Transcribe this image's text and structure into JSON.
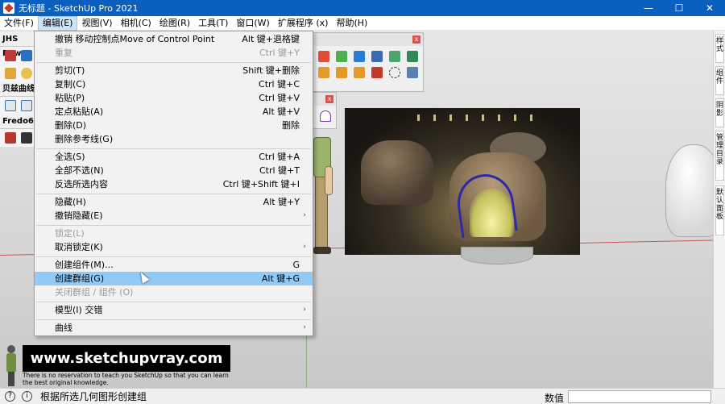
{
  "window": {
    "title": "无标题 - SketchUp Pro 2021",
    "controls": [
      "—",
      "☐",
      "✕"
    ]
  },
  "menubar": [
    "文件(F)",
    "编辑(E)",
    "视图(V)",
    "相机(C)",
    "绘图(R)",
    "工具(T)",
    "窗口(W)",
    "扩展程序 (x)",
    "帮助(H)"
  ],
  "left_toolbars": {
    "jhs_title": "JHS Pow",
    "bezier_title": "贝兹曲线",
    "fredo_title": "Fredo6_"
  },
  "edit_menu": [
    {
      "label": "撤销 移动控制点Move of Control Point",
      "shortcut": "Alt 键+退格键",
      "disabled": false
    },
    {
      "label": "重复",
      "shortcut": "Ctrl 键+Y",
      "disabled": true
    },
    {
      "sep": true
    },
    {
      "label": "剪切(T)",
      "shortcut": "Shift 键+删除",
      "disabled": false
    },
    {
      "label": "复制(C)",
      "shortcut": "Ctrl 键+C",
      "disabled": false
    },
    {
      "label": "粘贴(P)",
      "shortcut": "Ctrl 键+V",
      "disabled": false
    },
    {
      "label": "定点粘贴(A)",
      "shortcut": "Alt 键+V",
      "disabled": false
    },
    {
      "label": "删除(D)",
      "shortcut": "删除",
      "disabled": false
    },
    {
      "label": "删除参考线(G)",
      "shortcut": "",
      "disabled": false
    },
    {
      "sep": true
    },
    {
      "label": "全选(S)",
      "shortcut": "Ctrl 键+A",
      "disabled": false
    },
    {
      "label": "全部不选(N)",
      "shortcut": "Ctrl 键+T",
      "disabled": false
    },
    {
      "label": "反选所选内容",
      "shortcut": "Ctrl 键+Shift 键+I",
      "disabled": false
    },
    {
      "sep": true
    },
    {
      "label": "隐藏(H)",
      "shortcut": "Alt 键+Y",
      "disabled": false
    },
    {
      "label": "撤销隐藏(E)",
      "shortcut": "",
      "submenu": true,
      "disabled": false
    },
    {
      "sep": true
    },
    {
      "label": "锁定(L)",
      "shortcut": "",
      "disabled": true
    },
    {
      "label": "取消锁定(K)",
      "shortcut": "",
      "submenu": true,
      "disabled": false
    },
    {
      "sep": true
    },
    {
      "label": "创建组件(M)...",
      "shortcut": "G",
      "disabled": false
    },
    {
      "label": "创建群组(G)",
      "shortcut": "Alt 键+G",
      "disabled": false,
      "highlighted": true
    },
    {
      "label": "关闭群组 / 组件 (O)",
      "shortcut": "",
      "disabled": true
    },
    {
      "sep": true
    },
    {
      "label": "模型(I) 交错",
      "shortcut": "",
      "submenu": true,
      "disabled": false
    },
    {
      "sep": true
    },
    {
      "label": "曲线",
      "shortcut": "",
      "submenu": true,
      "disabled": false
    }
  ],
  "right_dock_tabs": [
    "样式",
    "组件",
    "阴影",
    "管理目录",
    "默认面板"
  ],
  "watermark": {
    "url": "www.sketchupvray.com",
    "line1": "There is no reservation to teach you SketchUp so that you can learn",
    "line2": "the best original knowledge."
  },
  "statusbar": {
    "text": "根据所选几何图形创建组",
    "measure_label": "数值",
    "measure_value": ""
  },
  "colors": {
    "titlebar": "#0b5fbf",
    "menu_highlight": "#91c9f7",
    "red_axis": "#c0392b"
  }
}
